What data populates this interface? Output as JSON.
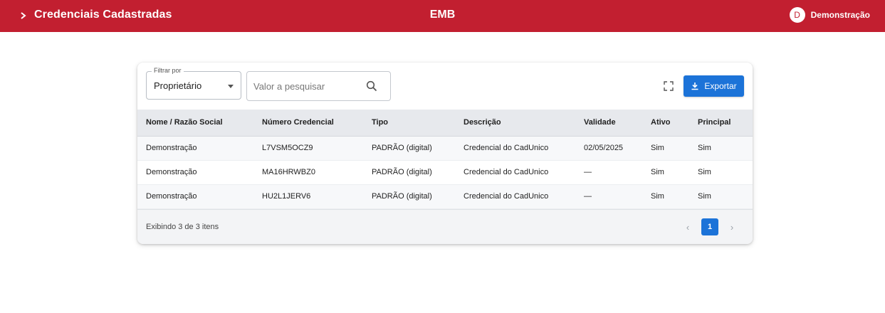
{
  "header": {
    "title": "Credenciais Cadastradas",
    "brand": "EMB",
    "user_initial": "D",
    "user_name": "Demonstração",
    "colors": {
      "bar": "#c21f30"
    }
  },
  "toolbar": {
    "filter_legend": "Filtrar por",
    "filter_value": "Proprietário",
    "search_placeholder": "Valor a pesquisar",
    "export_label": "Exportar",
    "icons": [
      "search-icon",
      "fullscreen-icon",
      "download-icon"
    ]
  },
  "table": {
    "columns": [
      "Nome / Razão Social",
      "Número Credencial",
      "Tipo",
      "Descrição",
      "Validade",
      "Ativo",
      "Principal"
    ],
    "rows": [
      [
        "Demonstração",
        "L7VSM5OCZ9",
        "PADRÃO (digital)",
        "Credencial do CadUnico",
        "02/05/2025",
        "Sim",
        "Sim"
      ],
      [
        "Demonstração",
        "MA16HRWBZ0",
        "PADRÃO (digital)",
        "Credencial do CadUnico",
        "—",
        "Sim",
        "Sim"
      ],
      [
        "Demonstração",
        "HU2L1JERV6",
        "PADRÃO (digital)",
        "Credencial do CadUnico",
        "—",
        "Sim",
        "Sim"
      ]
    ]
  },
  "footer": {
    "count_text": "Exibindo 3 de 3 itens",
    "current_page": "1",
    "prev_glyph": "‹",
    "next_glyph": "›"
  },
  "colors": {
    "primary": "#1c73d8"
  }
}
